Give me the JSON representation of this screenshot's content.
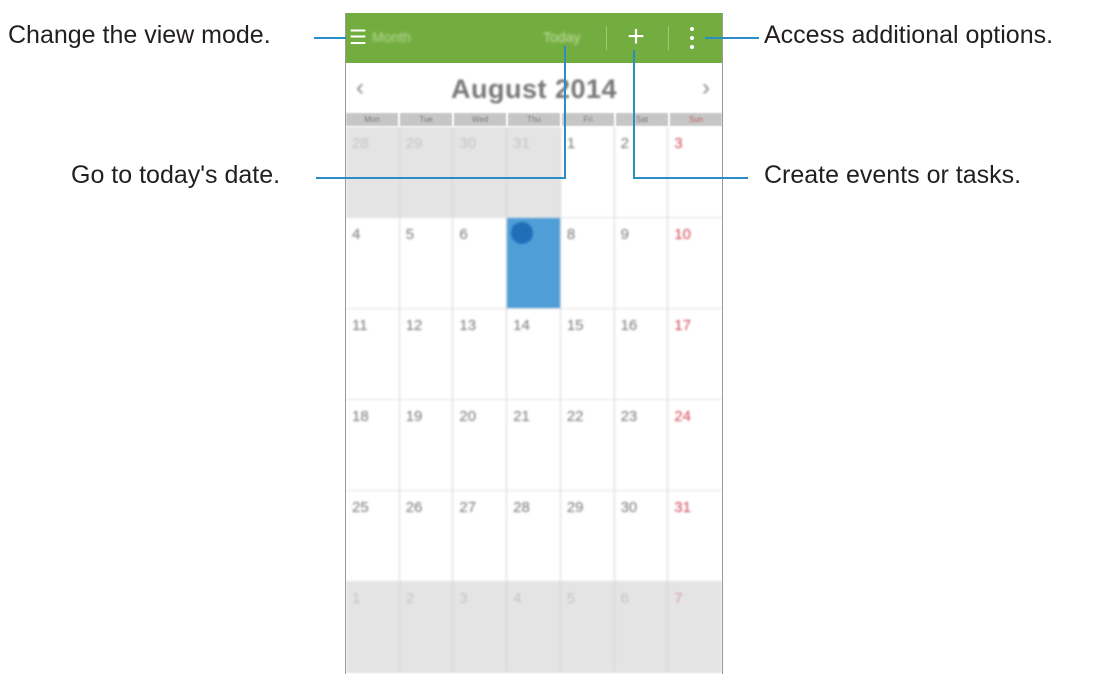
{
  "callouts": {
    "view_mode": "Change the view mode.",
    "today": "Go to today's date.",
    "more_options": "Access additional options.",
    "create": "Create events or tasks."
  },
  "toolbar": {
    "menu_icon": "hamburger-menu-icon",
    "view_mode_label": "Month",
    "today_label": "Today",
    "add_icon": "+",
    "more_icon": "vertical-dots-icon",
    "color": "#73ad3f"
  },
  "month_nav": {
    "prev": "‹",
    "title": "August 2014",
    "next": "›"
  },
  "weekdays": [
    "Mon",
    "Tue",
    "Wed",
    "Thu",
    "Fri",
    "Sat",
    "Sun"
  ],
  "calendar": {
    "today": "7",
    "weeks": [
      [
        "28",
        "29",
        "30",
        "31",
        "1",
        "2",
        "3"
      ],
      [
        "4",
        "5",
        "6",
        "7",
        "8",
        "9",
        "10"
      ],
      [
        "11",
        "12",
        "13",
        "14",
        "15",
        "16",
        "17"
      ],
      [
        "18",
        "19",
        "20",
        "21",
        "22",
        "23",
        "24"
      ],
      [
        "25",
        "26",
        "27",
        "28",
        "29",
        "30",
        "31"
      ],
      [
        "1",
        "2",
        "3",
        "4",
        "5",
        "6",
        "7"
      ]
    ],
    "colors": {
      "today_fill": "#4f9ed8",
      "sunday_text": "#d24654",
      "other_month_bg": "#e4e4e4"
    }
  },
  "callout_line_color": "#2a8dc5"
}
